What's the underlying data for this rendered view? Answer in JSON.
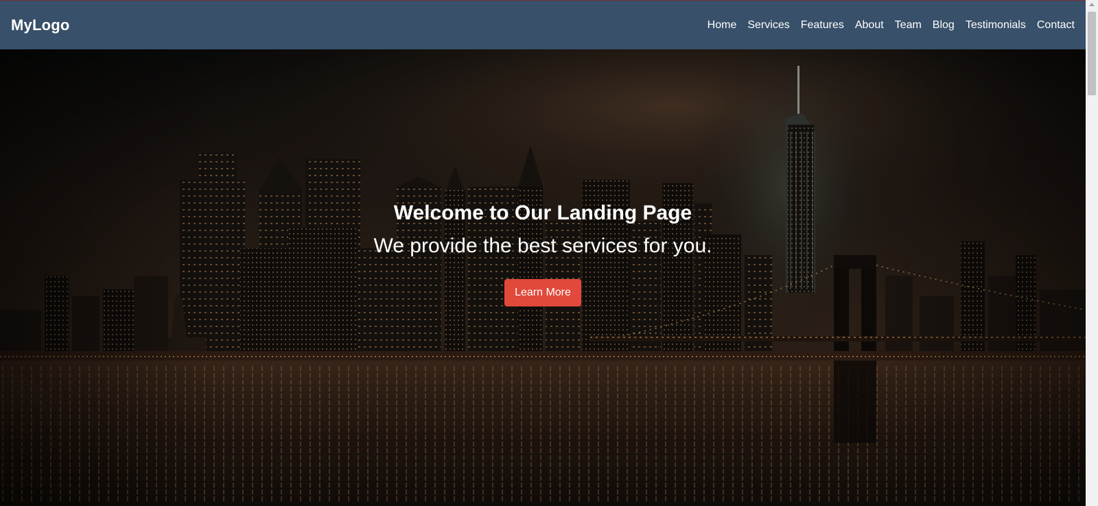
{
  "header": {
    "logo": "MyLogo",
    "nav": [
      "Home",
      "Services",
      "Features",
      "About",
      "Team",
      "Blog",
      "Testimonials",
      "Contact"
    ]
  },
  "hero": {
    "title": "Welcome to Our Landing Page",
    "subtitle": "We provide the best services for you.",
    "cta_label": "Learn More"
  },
  "colors": {
    "header_bg": "#385069",
    "cta_bg": "#e1493b",
    "text": "#ffffff"
  },
  "icons": {
    "scroll_up": "scroll-up-arrow-icon"
  }
}
